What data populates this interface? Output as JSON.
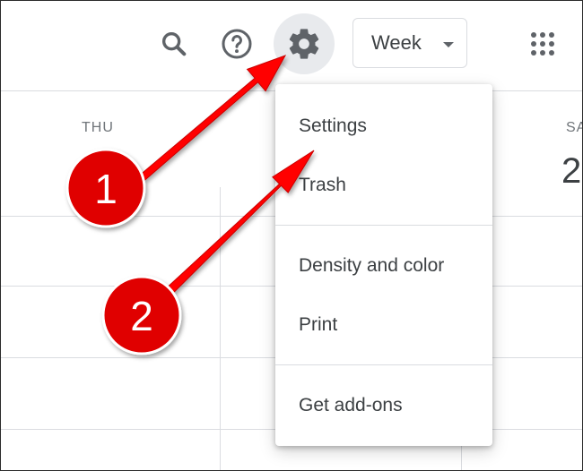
{
  "header": {
    "search_icon": "search-icon",
    "help_icon": "help-icon",
    "settings_icon": "gear-icon",
    "view_select": "Week",
    "apps_icon": "apps-grid-icon"
  },
  "calendar": {
    "day_thu": "THU",
    "day_sat": "SA",
    "sat_date": "2"
  },
  "menu": {
    "items": [
      {
        "label": "Settings"
      },
      {
        "label": "Trash"
      },
      {
        "label": "Density and color"
      },
      {
        "label": "Print"
      },
      {
        "label": "Get add-ons"
      }
    ]
  },
  "annotations": {
    "step1": "1",
    "step2": "2",
    "arrow_color": "#ff0000",
    "badge_color": "#e00000"
  }
}
